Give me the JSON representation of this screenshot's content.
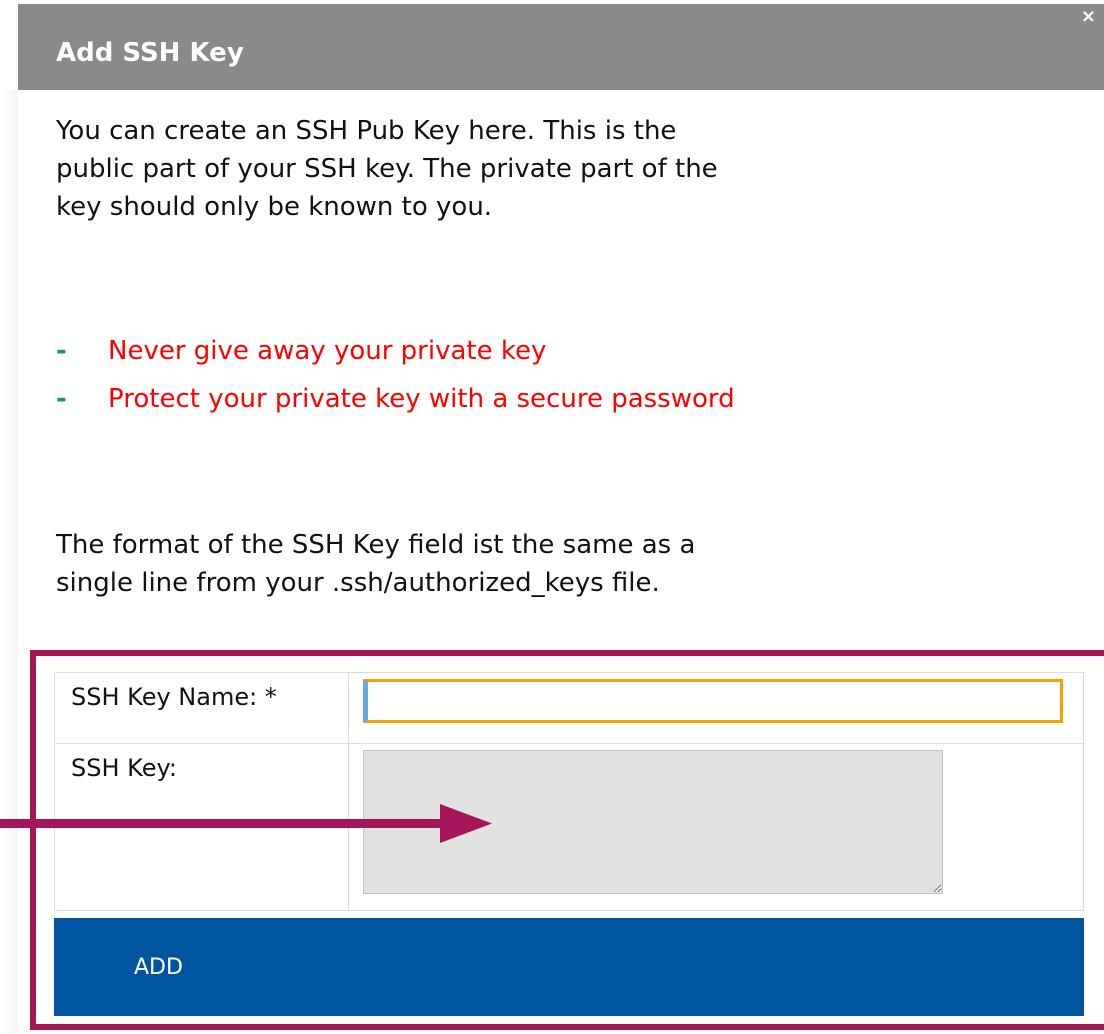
{
  "dialog": {
    "title": "Add SSH Key",
    "close_label": "×"
  },
  "intro": {
    "paragraph": "You can create an SSH Pub Key here. This is the public part of your SSH key. The private part of the key should only be known to you.",
    "warnings": [
      "Never give away your private key",
      "Protect your private key with a secure password"
    ],
    "format_note": "The format of the SSH Key field ist the same as a single line from your .ssh/authorized_keys file."
  },
  "form": {
    "name_label": "SSH Key Name: *",
    "name_value": "",
    "key_label": "SSH Key:",
    "key_value": "",
    "submit_label": "ADD"
  },
  "colors": {
    "titlebar": "#8a8a8a",
    "warning_text": "#ff0000",
    "dash": "#009988",
    "button": "#0055a0",
    "annotation": "#a5155a",
    "focus_border": "#f0a500"
  },
  "icons": {
    "close": "close-icon",
    "annotation_arrow": "arrow-right-icon"
  }
}
